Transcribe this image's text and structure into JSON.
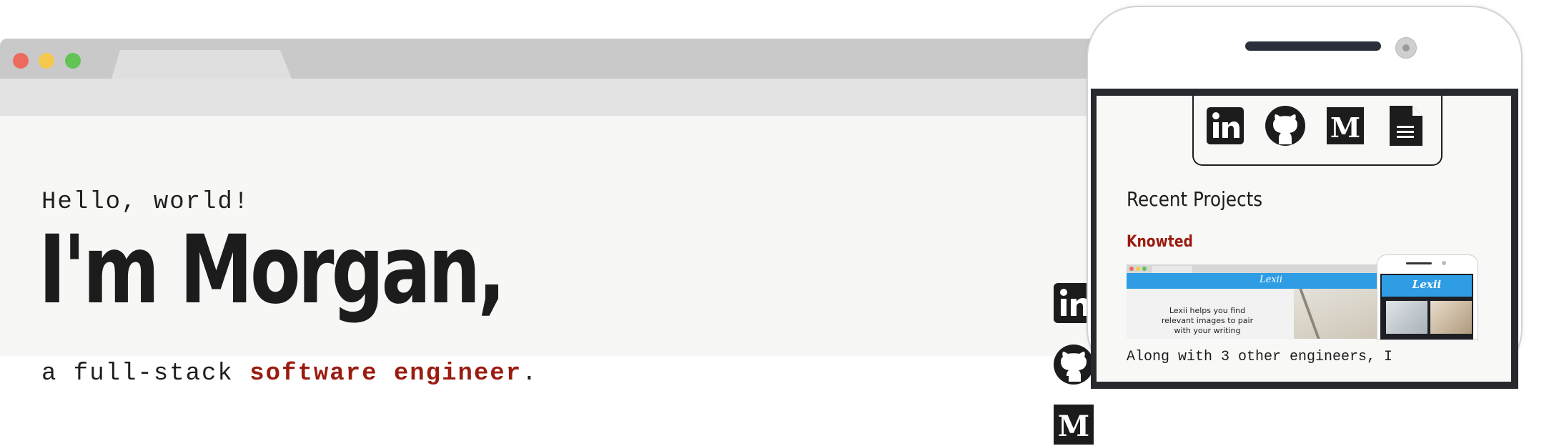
{
  "hero": {
    "greeting": "Hello, world!",
    "name": "I'm Morgan,",
    "tagline_prefix": "a full-stack ",
    "tagline_highlight": "software engineer",
    "tagline_suffix": "."
  },
  "social_icons": [
    "linkedin-icon",
    "github-icon",
    "medium-icon",
    "document-icon"
  ],
  "mobile": {
    "section_title": "Recent Projects",
    "project": {
      "name": "Knowted",
      "preview": {
        "brand": "Lexii",
        "caption": "Lexii helps you find relevant images to pair with your writing"
      },
      "description": "Along with 3 other engineers, I"
    }
  },
  "colors": {
    "accent": "#9a1c10",
    "text": "#1c1c1c",
    "page_bg": "#f7f7f5",
    "browser_chrome": "#c9c9c9",
    "preview_blue": "#2f9de4"
  }
}
